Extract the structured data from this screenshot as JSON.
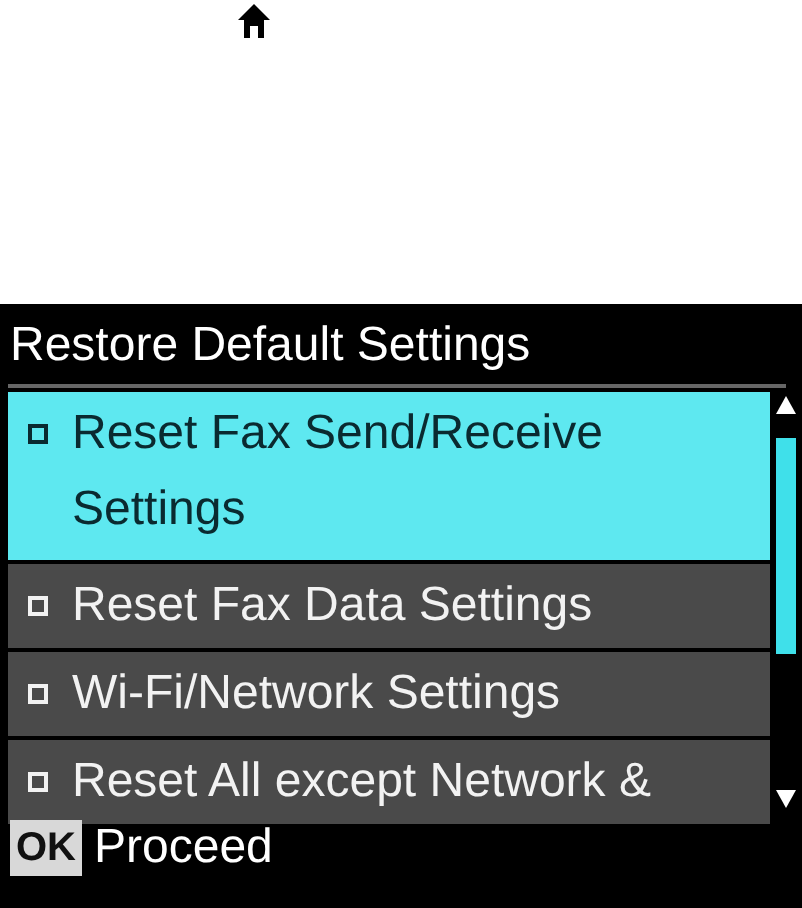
{
  "title": "Restore Default Settings",
  "items": [
    {
      "label": "Reset Fax Send/Receive Settings",
      "selected": true
    },
    {
      "label": "Reset Fax Data Settings",
      "selected": false
    },
    {
      "label": "Wi-Fi/Network Settings",
      "selected": false
    },
    {
      "label": "Reset All except Network &",
      "selected": false
    }
  ],
  "footer": {
    "key": "OK",
    "label": "Proceed"
  }
}
